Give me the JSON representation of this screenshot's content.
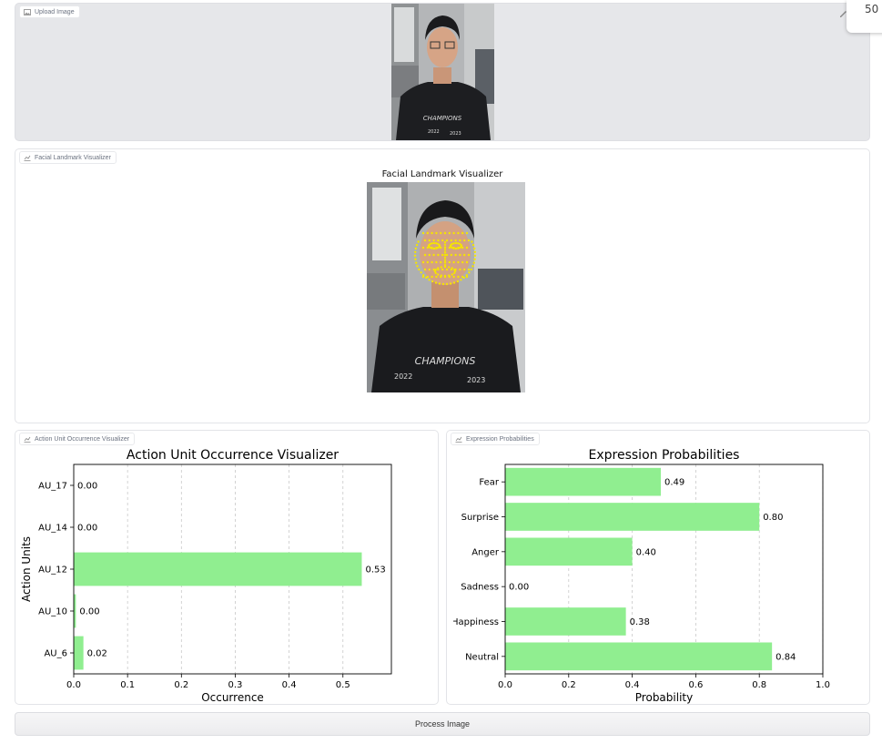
{
  "upload_panel": {
    "label": "Upload Image"
  },
  "landmark_panel": {
    "label": "Facial Landmark Visualizer",
    "title": "Facial Landmark Visualizer"
  },
  "corner_widget": {
    "text": "50"
  },
  "au_panel": {
    "label": "Action Unit Occurrence Visualizer",
    "chart_data": {
      "type": "bar",
      "orientation": "horizontal",
      "title": "Action Unit Occurrence Visualizer",
      "xlabel": "Occurrence",
      "ylabel": "Action Units",
      "categories": [
        "AU_6",
        "AU_10",
        "AU_12",
        "AU_14",
        "AU_17"
      ],
      "values": [
        0.02,
        0.0,
        0.53,
        0.0,
        0.0
      ],
      "bar_values": [
        0.018,
        0.004,
        0.535,
        0.0,
        0.0
      ],
      "value_labels": [
        "0.02",
        "0.00",
        "0.53",
        "0.00",
        "0.00"
      ],
      "xlim": [
        0,
        0.59
      ],
      "xticks": [
        0.0,
        0.1,
        0.2,
        0.3,
        0.4,
        0.5
      ],
      "xtick_labels": [
        "0.0",
        "0.1",
        "0.2",
        "0.3",
        "0.4",
        "0.5"
      ],
      "bar_color": "#90ee90",
      "grid": "x-dashed"
    }
  },
  "expr_panel": {
    "label": "Expression Probabilities",
    "chart_data": {
      "type": "bar",
      "orientation": "horizontal",
      "title": "Expression Probabilities",
      "xlabel": "Probability",
      "ylabel": "",
      "categories": [
        "Neutral",
        "Happiness",
        "Sadness",
        "Anger",
        "Surprise",
        "Fear"
      ],
      "tick_labels": [
        "Neutral",
        "Happiness",
        "Sadness",
        "Anger",
        "Surprise",
        "Fear"
      ],
      "values": [
        0.84,
        0.38,
        0.0,
        0.4,
        0.8,
        0.49
      ],
      "value_labels": [
        "0.84",
        "0.38",
        "0.00",
        "0.40",
        "0.80",
        "0.49"
      ],
      "xlim": [
        0,
        1.0
      ],
      "xticks": [
        0.0,
        0.2,
        0.4,
        0.6,
        0.8,
        1.0
      ],
      "xtick_labels": [
        "0.0",
        "0.2",
        "0.4",
        "0.6",
        "0.8",
        "1.0"
      ],
      "bar_color": "#90ee90",
      "grid": "x-dashed"
    }
  },
  "process_button": {
    "label": "Process Image"
  }
}
